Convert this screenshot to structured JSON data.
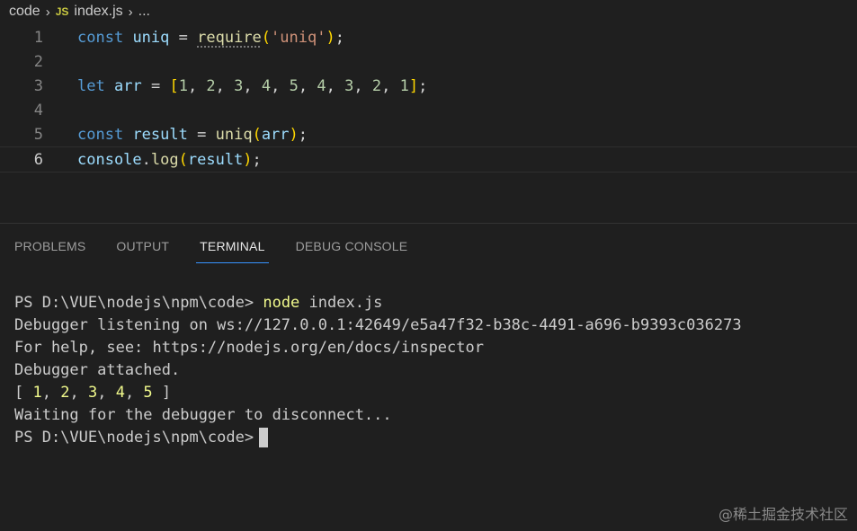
{
  "breadcrumb": {
    "folder": "code",
    "file_icon": "JS",
    "file": "index.js",
    "more": "..."
  },
  "editor": {
    "line_numbers": [
      "1",
      "2",
      "3",
      "4",
      "5",
      "6"
    ],
    "active_line": 6,
    "lines": [
      "const uniq = require('uniq');",
      "",
      "let arr = [1, 2, 3, 4, 5, 4, 3, 2, 1];",
      "",
      "const result = uniq(arr);",
      "console.log(result);"
    ]
  },
  "panel": {
    "tabs": [
      "PROBLEMS",
      "OUTPUT",
      "TERMINAL",
      "DEBUG CONSOLE"
    ],
    "active_tab": "TERMINAL"
  },
  "terminal": {
    "prompt1": "PS D:\\VUE\\nodejs\\npm\\code> ",
    "command": "node",
    "command_args": " index.js",
    "line2": "Debugger listening on ws://127.0.0.1:42649/e5a47f32-b38c-4491-a696-b9393c036273",
    "line3": "For help, see: https://nodejs.org/en/docs/inspector",
    "line4": "Debugger attached.",
    "line5_open": "[ ",
    "line5_values": [
      "1",
      "2",
      "3",
      "4",
      "5"
    ],
    "line5_close": " ]",
    "line6": "Waiting for the debugger to disconnect...",
    "prompt2": "PS D:\\VUE\\nodejs\\npm\\code>"
  },
  "watermark": "@稀土掘金技术社区",
  "colors": {
    "background": "#1f1f1f",
    "keyword": "#569cd6",
    "variable": "#9cdcfe",
    "function": "#dcdcaa",
    "string": "#ce9178",
    "number": "#b5cea8",
    "tab_active_underline": "#3794ff"
  }
}
